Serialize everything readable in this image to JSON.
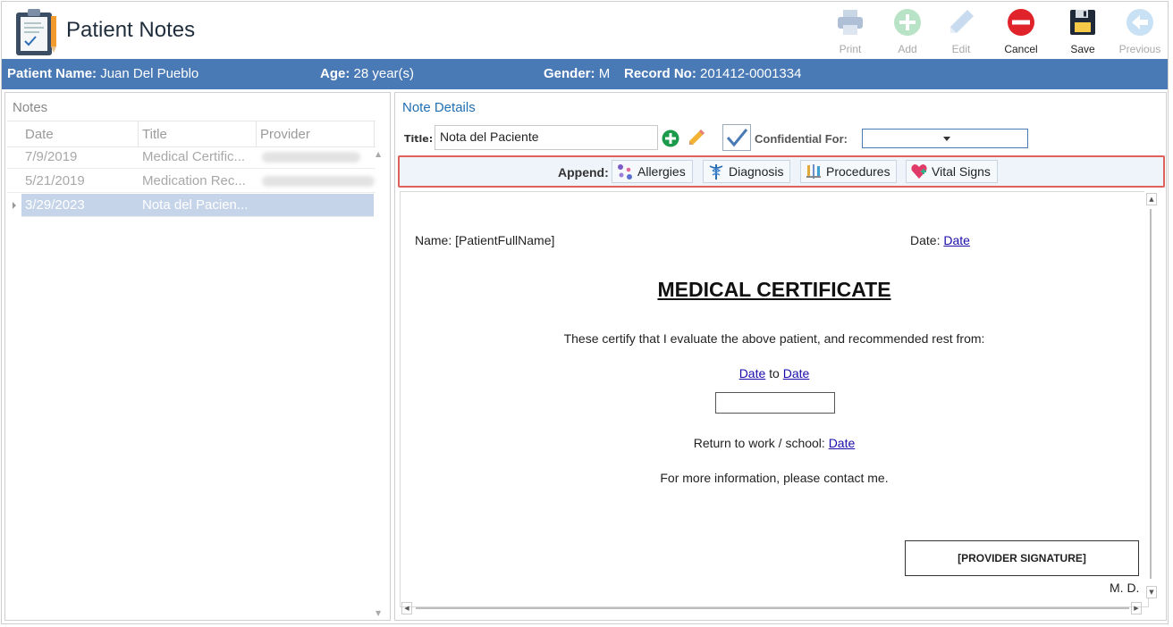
{
  "app": {
    "title": "Patient Notes",
    "logo_icon": "clipboard-notes-icon"
  },
  "toolbar": {
    "buttons": [
      {
        "label": "Print",
        "icon": "printer-icon",
        "enabled": false
      },
      {
        "label": "Add",
        "icon": "plus-circle-icon",
        "enabled": false
      },
      {
        "label": "Edit",
        "icon": "pencil-icon",
        "enabled": false
      },
      {
        "label": "Cancel",
        "icon": "minus-circle-icon",
        "enabled": true
      },
      {
        "label": "Save",
        "icon": "floppy-disk-icon",
        "enabled": true
      },
      {
        "label": "Previous",
        "icon": "arrow-left-circle-icon",
        "enabled": false
      }
    ]
  },
  "patient": {
    "name_label": "Patient Name:",
    "name": "Juan Del Pueblo",
    "age_label": "Age:",
    "age": "28 year(s)",
    "gender_label": "Gender:",
    "gender": "M",
    "record_label": "Record No:",
    "record": "201412-0001334",
    "bar_color": "#4a7ab5"
  },
  "notes": {
    "title": "Notes",
    "columns": [
      "Date",
      "Title",
      "Provider"
    ],
    "rows": [
      {
        "date": "7/9/2019",
        "title": "Medical Certific...",
        "provider": ""
      },
      {
        "date": "5/21/2019",
        "title": "Medication Rec...",
        "provider": ""
      },
      {
        "date": "3/29/2023",
        "title": "Nota del Pacien...",
        "provider": "",
        "selected": true
      }
    ]
  },
  "details": {
    "title": "Note Details",
    "title_label": "Title:",
    "title_value": "Nota del Paciente",
    "confidential_label": "Confidential For:",
    "confidential_checked": true,
    "confidential_value": "",
    "append_label": "Append:",
    "append_buttons": [
      {
        "label": "Allergies",
        "icon": "allergies-icon"
      },
      {
        "label": "Diagnosis",
        "icon": "caduceus-icon"
      },
      {
        "label": "Procedures",
        "icon": "medical-tools-icon"
      },
      {
        "label": "Vital Signs",
        "icon": "heart-plus-icon"
      }
    ],
    "highlight_color": "#e0605a"
  },
  "document": {
    "name_text": "Name: [PatientFullName]",
    "date_label": "Date:",
    "date_link": "Date",
    "heading": "MEDICAL CERTIFICATE",
    "certify_text": "These certify that I evaluate the above patient, and recommended rest from:",
    "range_from": "Date",
    "range_to_word": "to",
    "range_to": "Date",
    "return_label": "Return to work / school:",
    "return_link": "Date",
    "info_text": "For more information, please contact me.",
    "signature": "[PROVIDER SIGNATURE]",
    "md_text": "M. D."
  }
}
